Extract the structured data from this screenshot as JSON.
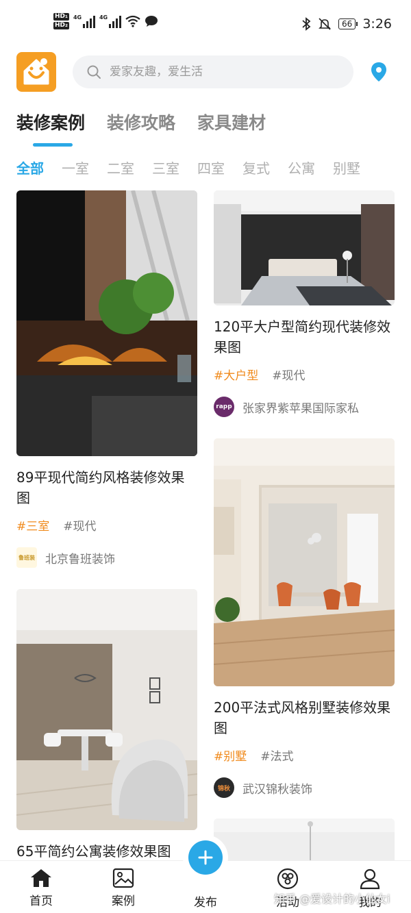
{
  "status_bar": {
    "network_1": "4G",
    "network_2": "4G",
    "battery": "66",
    "time": "3:26"
  },
  "header": {
    "search_placeholder": "爱家友趣，爱生活"
  },
  "main_tabs": [
    {
      "label": "装修案例",
      "active": true
    },
    {
      "label": "装修攻略",
      "active": false
    },
    {
      "label": "家具建材",
      "active": false
    }
  ],
  "category_tabs": [
    "全部",
    "一室",
    "二室",
    "三室",
    "四室",
    "复式",
    "公寓",
    "别墅"
  ],
  "feed": {
    "left": [
      {
        "title": "89平现代简约风格装修效果图",
        "tags": [
          "#三室",
          "#现代"
        ],
        "author": "北京鲁班装饰",
        "avatar_text": "鲁班装"
      },
      {
        "title": "65平简约公寓装修效果图",
        "tags": [],
        "author": "",
        "avatar_text": ""
      }
    ],
    "right": [
      {
        "title": "120平大户型简约现代装修效果图",
        "tags": [
          "#大户型",
          "#现代"
        ],
        "author": "张家界紫苹果国际家私",
        "avatar_text": "rapp"
      },
      {
        "title": "200平法式风格别墅装修效果图",
        "tags": [
          "#别墅",
          "#法式"
        ],
        "author": "武汉锦秋装饰",
        "avatar_text": "锦秋"
      }
    ]
  },
  "bottom_nav": {
    "home": "首页",
    "cases": "案例",
    "publish": "发布",
    "activity": "活动",
    "mine": "我的"
  },
  "watermark": "知乎 @爱设计的小仙女i",
  "colors": {
    "accent": "#2aa8e6",
    "tag": "#f08a1c",
    "logo": "#f59e23"
  }
}
